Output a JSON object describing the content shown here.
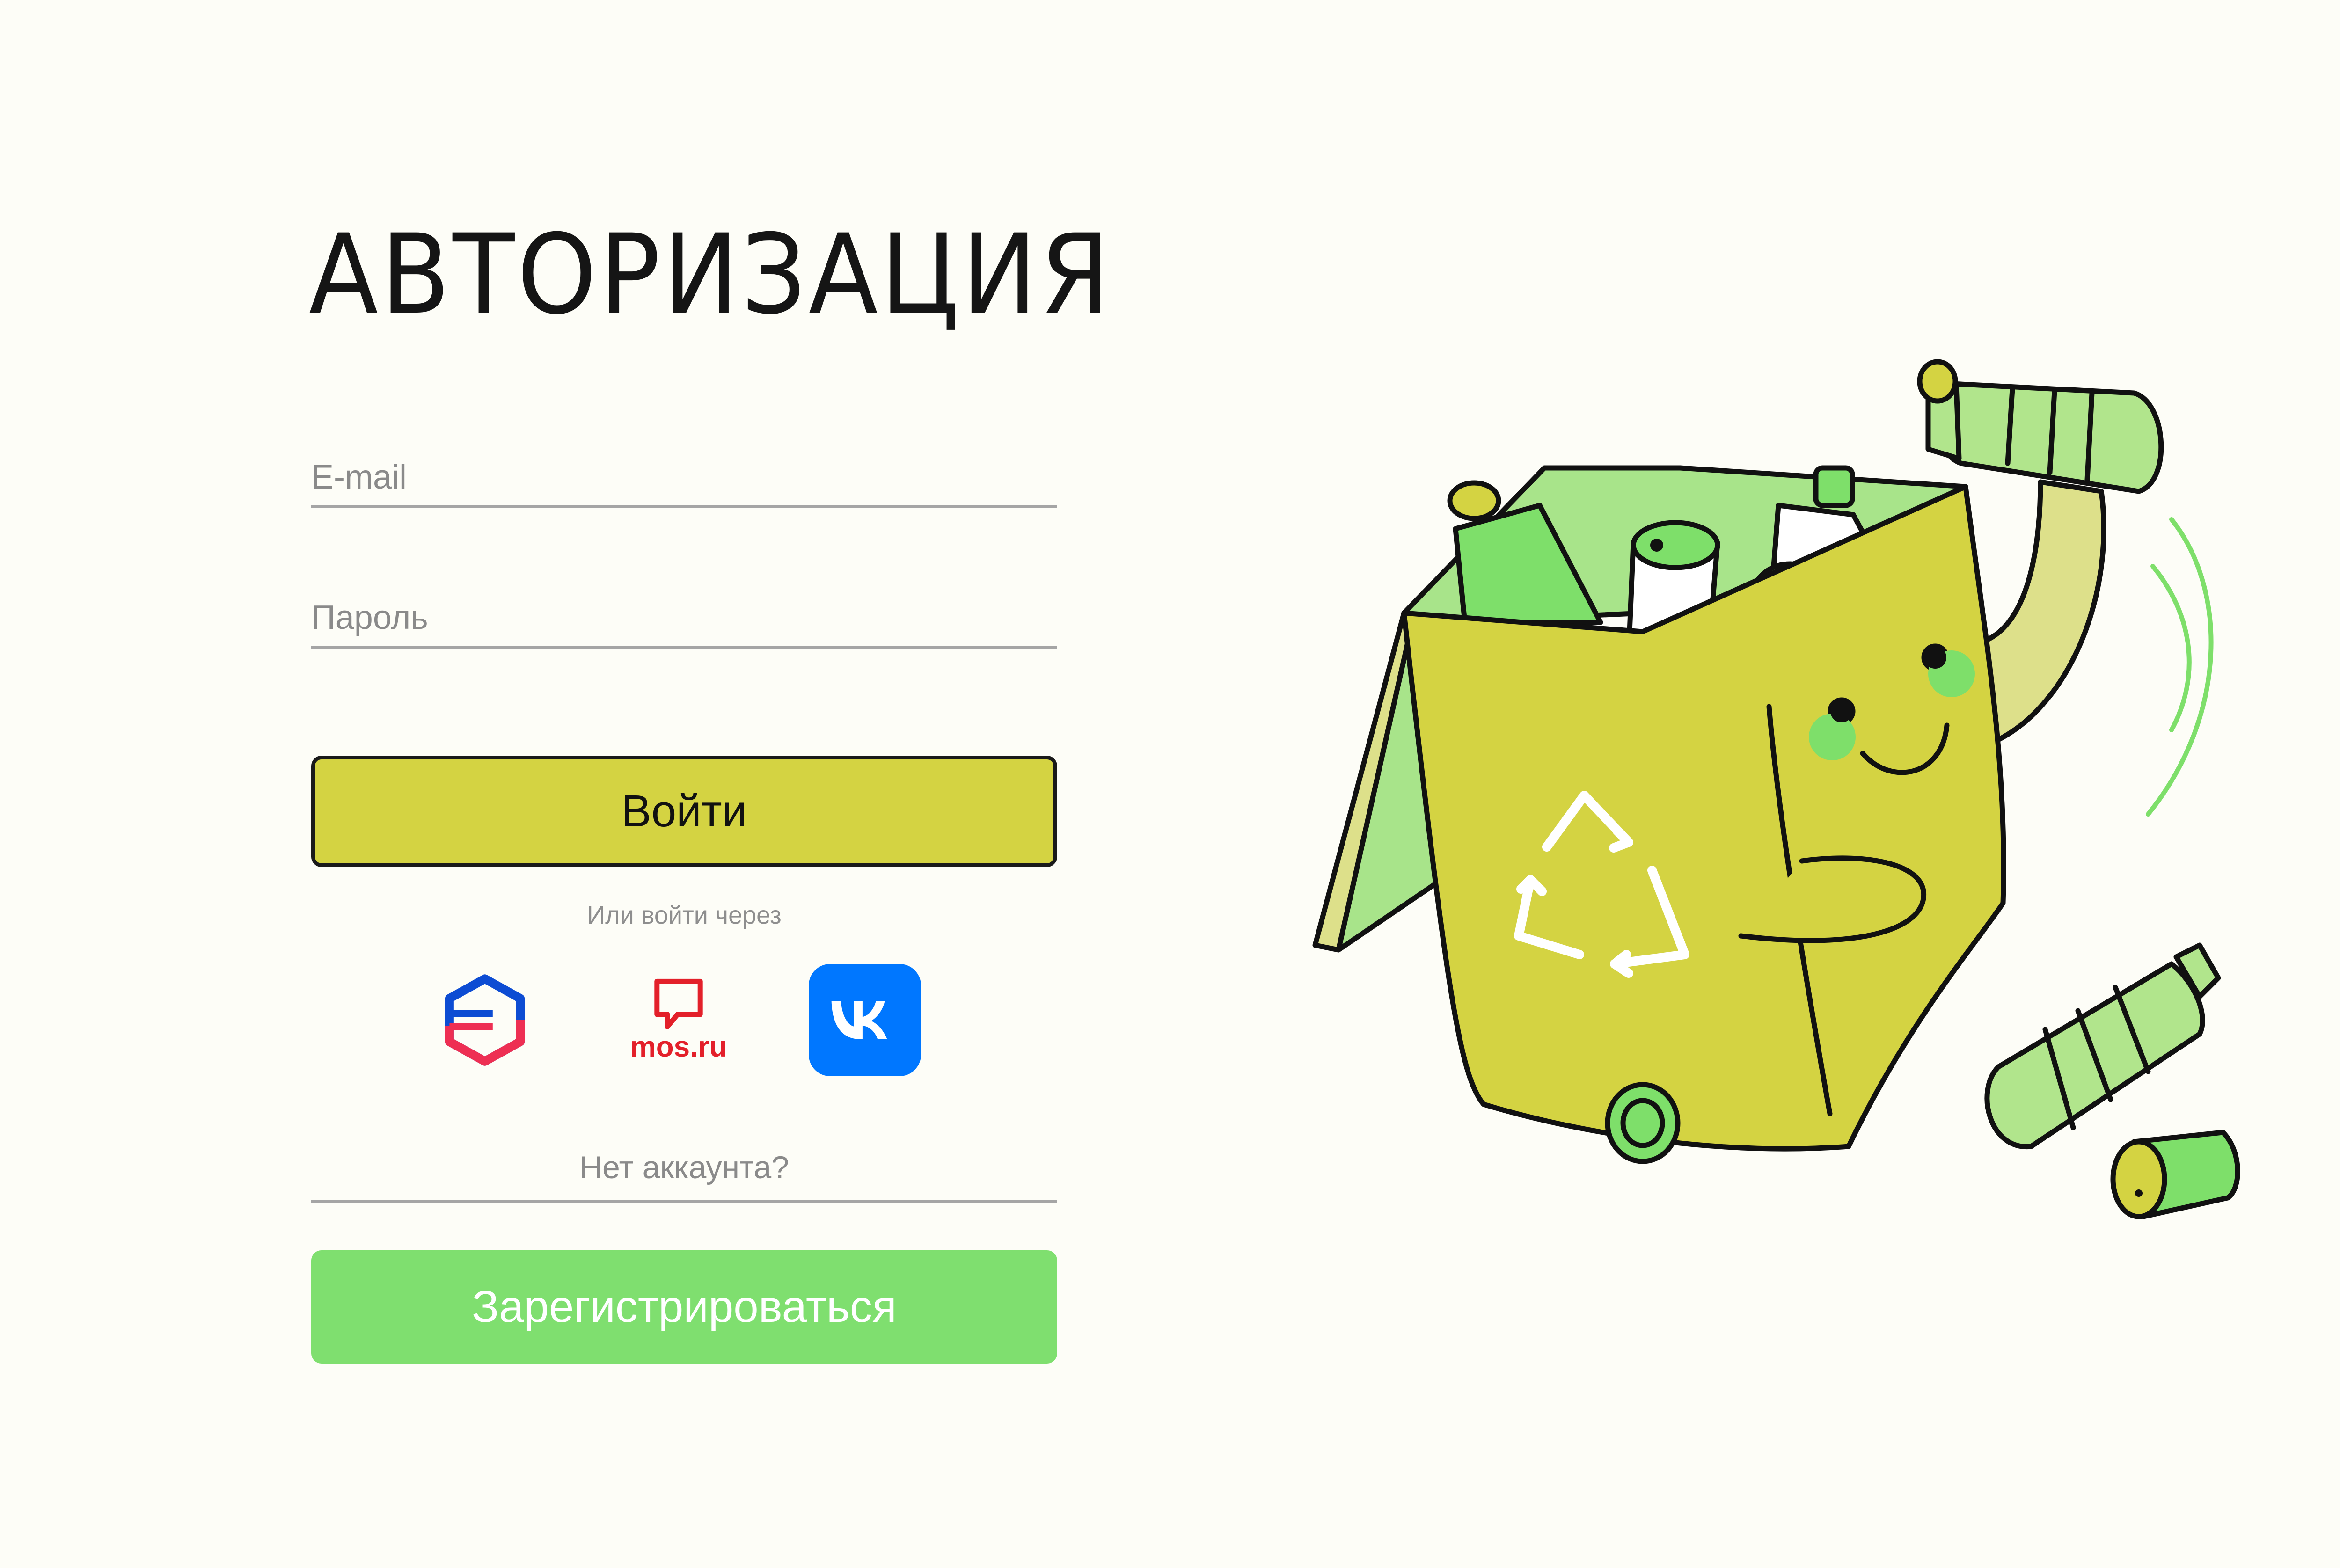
{
  "page": {
    "title": "АВТОРИЗАЦИЯ"
  },
  "form": {
    "email_placeholder": "E-mail",
    "email_value": "",
    "password_placeholder": "Пароль",
    "password_value": "",
    "login_label": "Войти"
  },
  "alt_login": {
    "text": "Или войти через",
    "providers": [
      {
        "name": "gosuslugi",
        "icon": "gosuslugi-icon"
      },
      {
        "name": "mos.ru",
        "label": "mos.ru",
        "icon": "mos-ru-icon"
      },
      {
        "name": "vk",
        "icon": "vk-icon"
      }
    ]
  },
  "register": {
    "question": "Нет аккаунта?",
    "button_label": "Зарегистрироваться"
  },
  "colors": {
    "background": "#fdfdf7",
    "login_button": "#d4d342",
    "register_button": "#7fdf6f",
    "vk_blue": "#0077ff",
    "mos_red": "#e3202a"
  },
  "illustration": {
    "icon": "recycling-bin-mascot-icon"
  }
}
